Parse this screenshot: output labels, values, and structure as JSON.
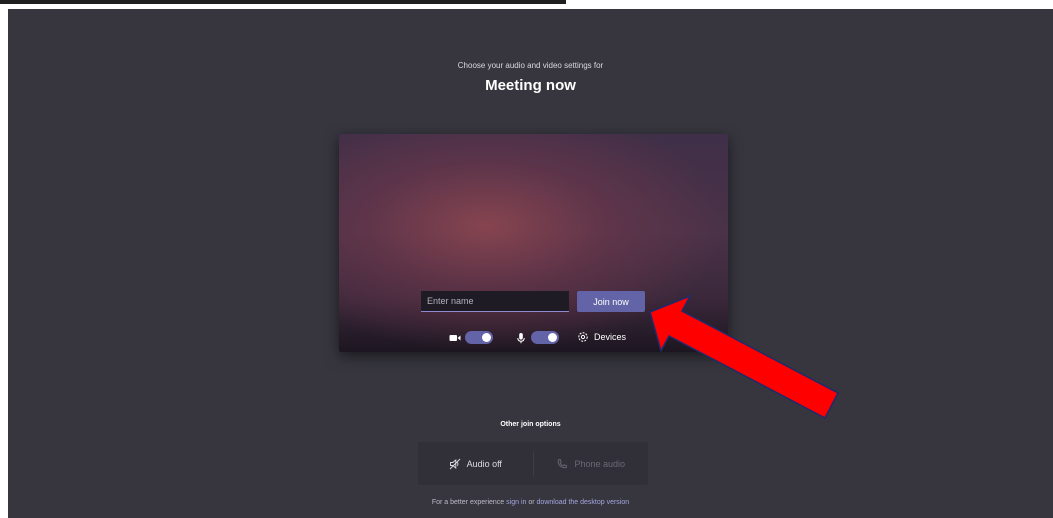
{
  "header": {
    "subtitle": "Choose your audio and video settings for",
    "title": "Meeting now"
  },
  "preview": {
    "name_placeholder": "Enter name",
    "name_value": "",
    "join_label": "Join now",
    "camera_on": true,
    "mic_on": true,
    "devices_label": "Devices"
  },
  "other_options": {
    "title": "Other join options",
    "audio_off_label": "Audio off",
    "phone_audio_label": "Phone audio"
  },
  "footer": {
    "prefix": "For a better experience",
    "sign_in_label": "sign in",
    "middle": "or",
    "download_label": "download the desktop version"
  },
  "colors": {
    "background": "#37363f",
    "accent": "#6264a7",
    "arrow": "#ff0000"
  }
}
